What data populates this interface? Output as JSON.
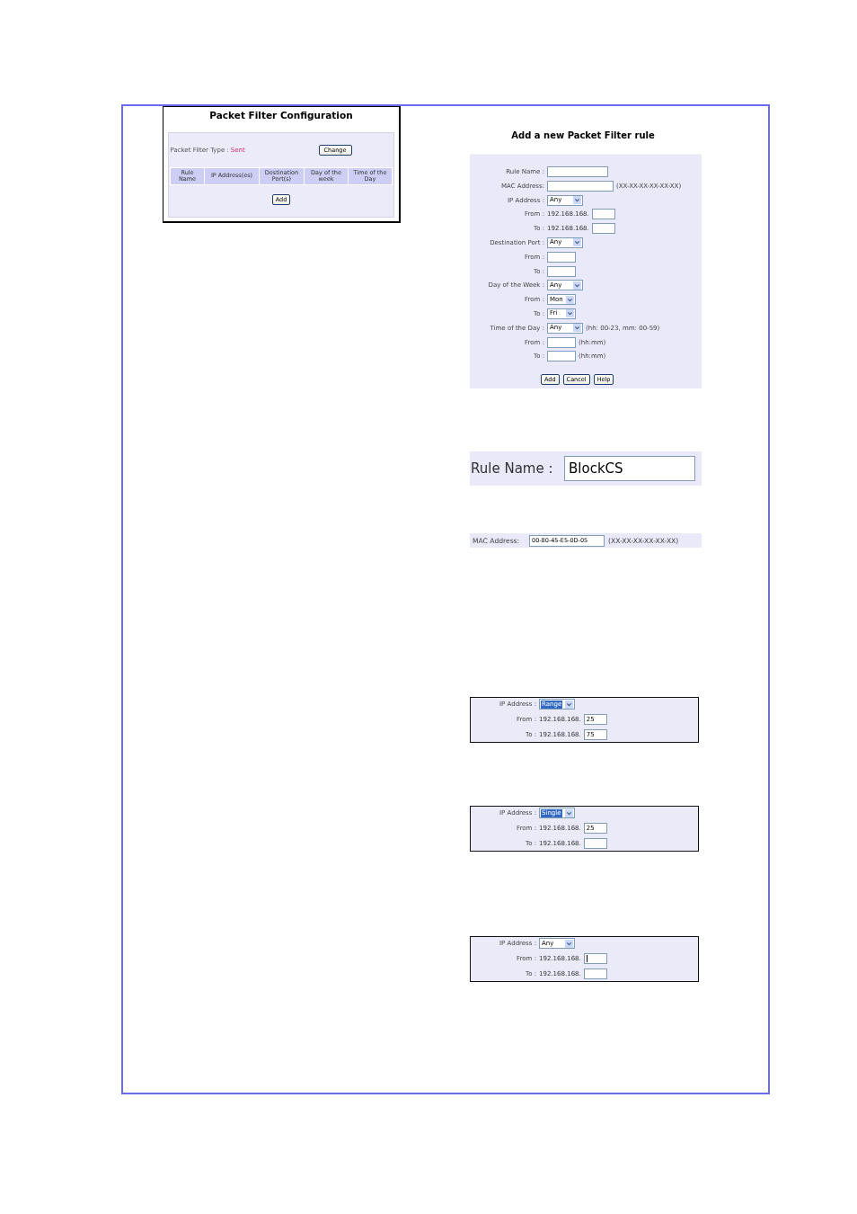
{
  "config_window": {
    "title": "Packet Filter Configuration",
    "filter_type_label": "Packet Filter Type :",
    "filter_type_value": "Sent",
    "change_button": "Change",
    "columns": [
      "Rule Name",
      "IP Address(es)",
      "Destination Port(s)",
      "Day of the week",
      "Time of the Day"
    ],
    "add_button": "Add"
  },
  "rule_form": {
    "title": "Add a new Packet Filter rule",
    "rows": [
      {
        "kind": "text",
        "label": "Rule Name :"
      },
      {
        "kind": "mac",
        "label": "MAC Address:",
        "hint": "(XX-XX-XX-XX-XX-XX)"
      },
      {
        "kind": "select",
        "label": "IP Address :",
        "value": "Any"
      },
      {
        "kind": "ip",
        "label": "From :",
        "prefix": "192.168.168."
      },
      {
        "kind": "ip",
        "label": "To :",
        "prefix": "192.168.168."
      },
      {
        "kind": "select",
        "label": "Destination Port :",
        "value": "Any"
      },
      {
        "kind": "port",
        "label": "From :"
      },
      {
        "kind": "port",
        "label": "To :"
      },
      {
        "kind": "select",
        "label": "Day of the Week :",
        "value": "Any"
      },
      {
        "kind": "day",
        "label": "From :",
        "value": "Mon"
      },
      {
        "kind": "day",
        "label": "To :",
        "value": "Fri"
      },
      {
        "kind": "select",
        "label": "Time of the Day :",
        "value": "Any",
        "hint": "(hh: 00-23, mm: 00-59)"
      },
      {
        "kind": "time",
        "label": "From :",
        "hint": "(hh:mm)"
      },
      {
        "kind": "time",
        "label": "To :",
        "hint": "(hh:mm)"
      }
    ],
    "buttons": [
      "Add",
      "Cancel",
      "Help"
    ]
  },
  "rule_name_example": {
    "label": "Rule Name :",
    "value": "BlockCS"
  },
  "mac_example": {
    "label": "MAC Address:",
    "value": "00-80-45-E5-0D-05",
    "hint": "(XX-XX-XX-XX-XX-XX)"
  },
  "ip_examples": [
    {
      "label": "IP Address :",
      "selection": "Range",
      "select_highlighted": true,
      "from_cursor": false,
      "from_label": "From :",
      "from_prefix": "192.168.168.",
      "from_value": "25",
      "to_label": "To :",
      "to_prefix": "192.168.168.",
      "to_value": "75"
    },
    {
      "label": "IP Address :",
      "selection": "Single",
      "select_highlighted": true,
      "from_cursor": false,
      "from_label": "From :",
      "from_prefix": "192.168.168.",
      "from_value": "25",
      "to_label": "To :",
      "to_prefix": "192.168.168."
    },
    {
      "label": "IP Address :",
      "selection": "Any",
      "select_highlighted": false,
      "from_cursor": true,
      "from_label": "From :",
      "from_prefix": "192.168.168.",
      "to_label": "To :",
      "to_prefix": "192.168.168."
    }
  ]
}
